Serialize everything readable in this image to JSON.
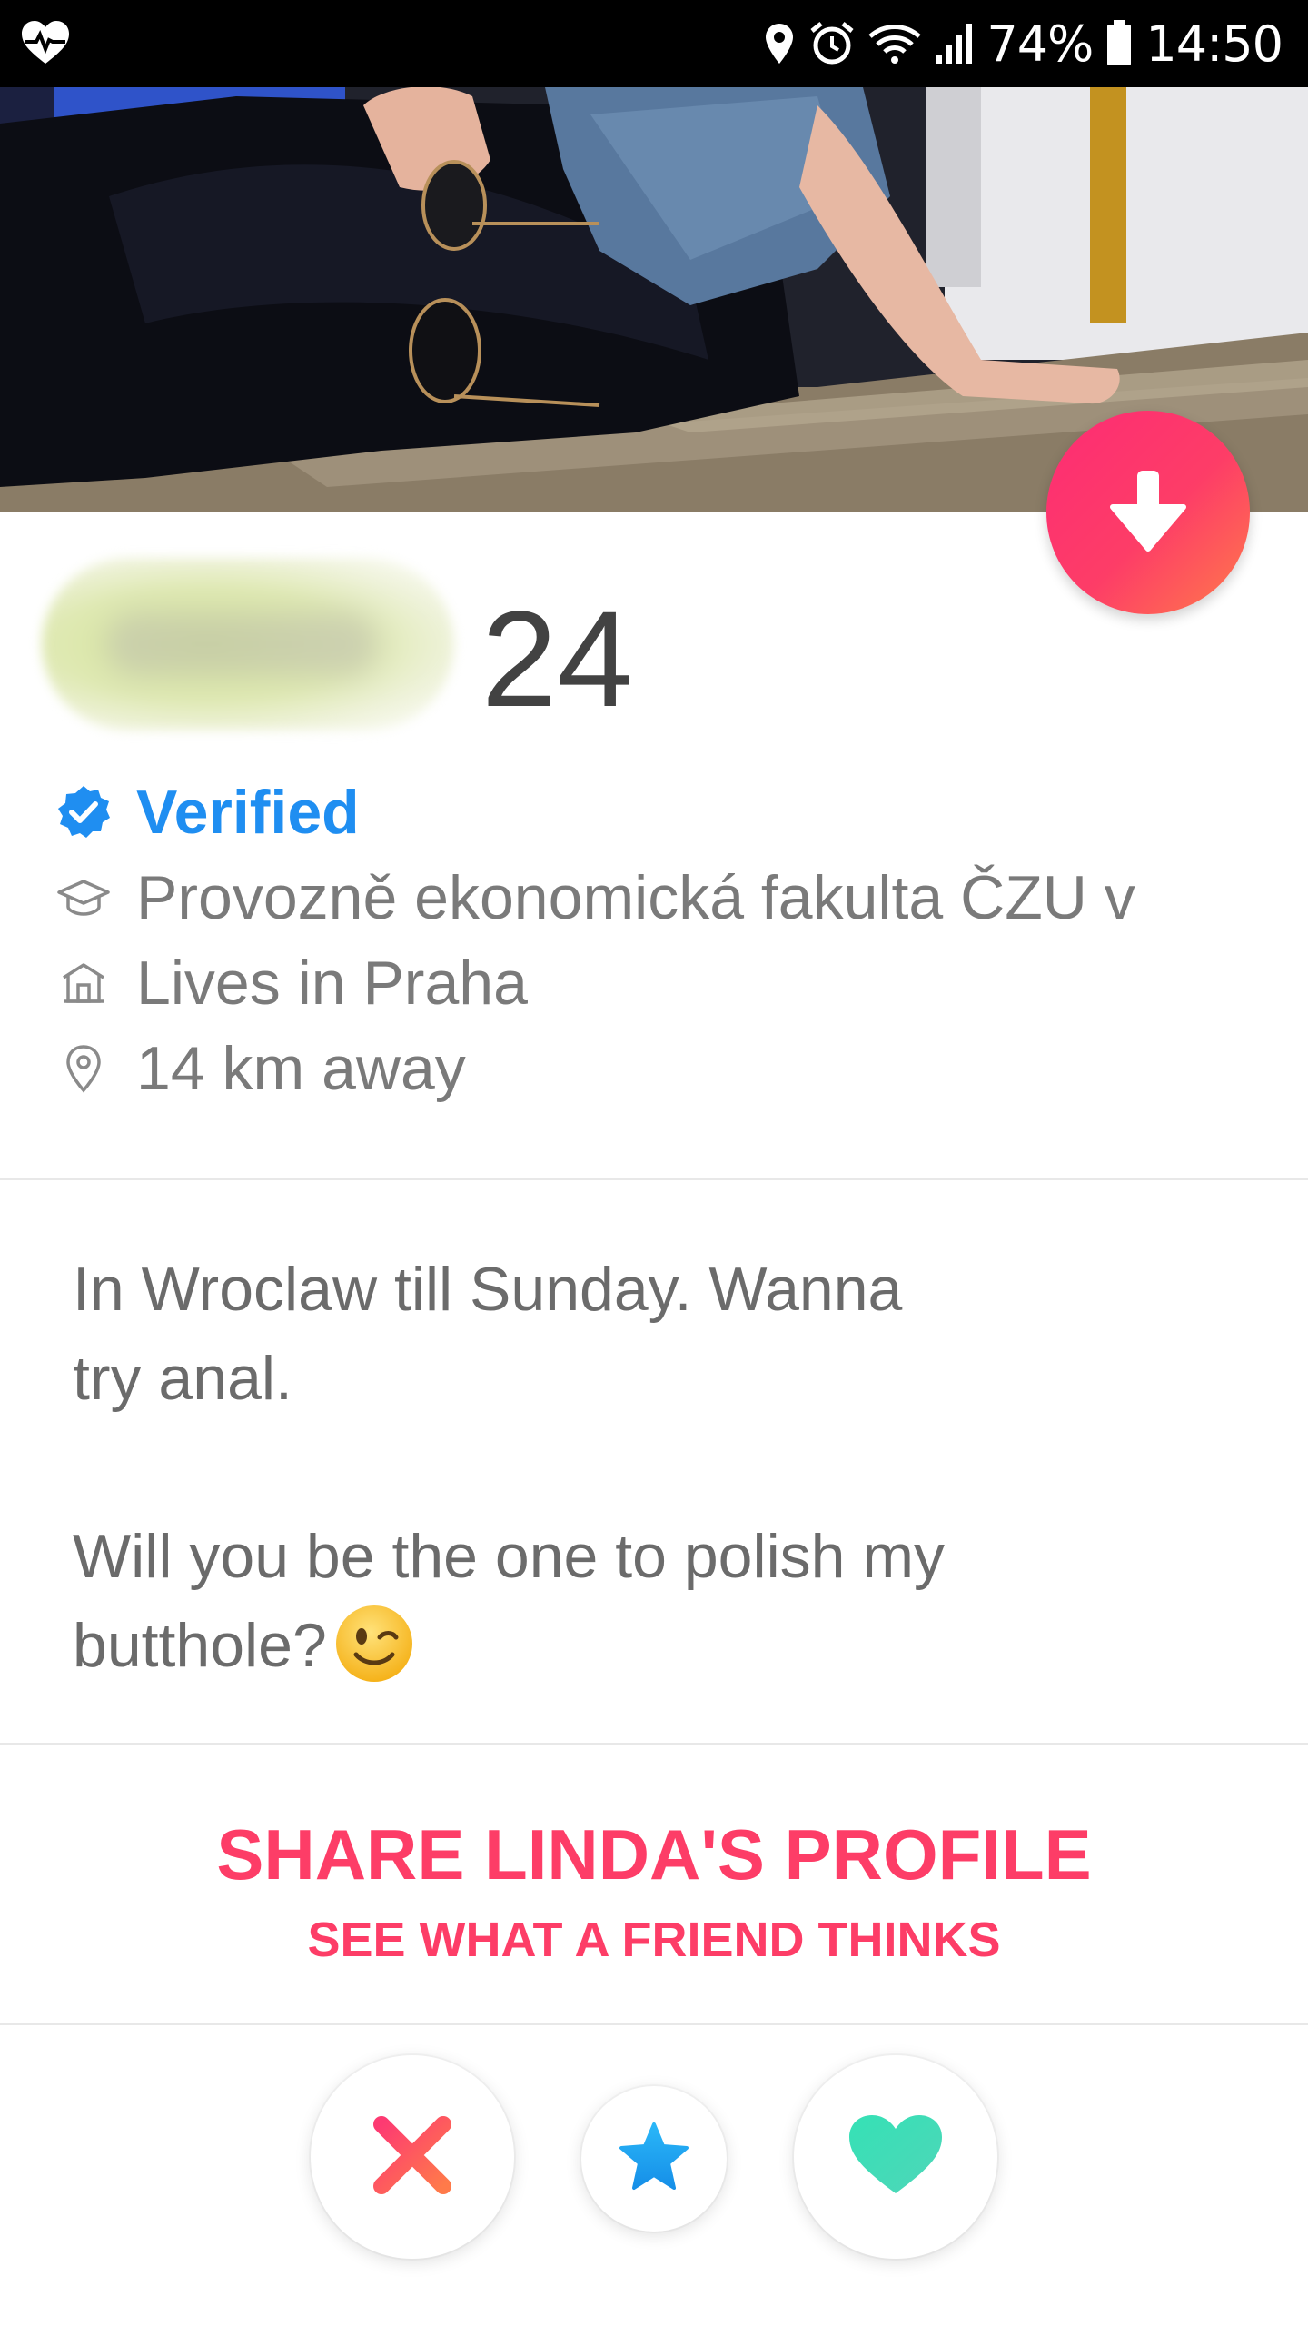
{
  "status_bar": {
    "battery": "74%",
    "time": "14:50",
    "icons": [
      "heart-pulse-icon",
      "location-icon",
      "alarm-icon",
      "wifi-icon",
      "signal-icon",
      "battery-icon"
    ]
  },
  "profile": {
    "age": "24",
    "verified_label": "Verified",
    "school": "Provozně ekonomická fakulta ČZU v",
    "lives_in": "Lives in Praha",
    "distance": "14 km away"
  },
  "bio": {
    "line1": "In Wroclaw till Sunday. Wanna",
    "line2": "try anal.",
    "line3": "Will you be the one to polish my",
    "line4": "butthole?",
    "emoji": "winking-face-emoji"
  },
  "share": {
    "title": "SHARE LINDA'S PROFILE",
    "subtitle": "SEE WHAT A FRIEND THINKS"
  },
  "actions": {
    "nope": "close-icon",
    "super_like": "star-icon",
    "like": "heart-icon"
  },
  "colors": {
    "brand_gradient_start": "#fd2c74",
    "brand_gradient_end": "#ff7b4a",
    "share_text": "#fd3d67",
    "verified_blue": "#1f8ef1",
    "like_teal": "#3be0b4",
    "super_like_blue": "#1ea5f5",
    "nope_red": "#fd4b5e"
  }
}
